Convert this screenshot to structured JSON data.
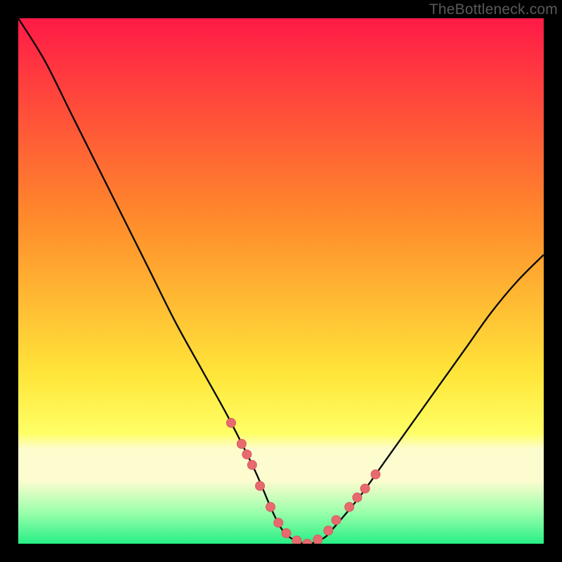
{
  "watermark": "TheBottleneck.com",
  "colors": {
    "frame": "#000000",
    "grad_top": "#ff1a47",
    "grad_mid1": "#ff8a2b",
    "grad_mid2": "#ffe63a",
    "grad_band_pale": "#fdfccf",
    "grad_bottom": "#27ef86",
    "curve": "#0a0a0a",
    "marker_fill": "#e66a6e",
    "marker_stroke": "#d85a5e"
  },
  "chart_data": {
    "type": "line",
    "title": "",
    "xlabel": "",
    "ylabel": "",
    "xlim": [
      0,
      100
    ],
    "ylim": [
      0,
      100
    ],
    "series": [
      {
        "name": "bottleneck-curve",
        "x": [
          0,
          5,
          10,
          15,
          20,
          25,
          30,
          35,
          40,
          45,
          48,
          50,
          52,
          55,
          58,
          60,
          65,
          70,
          75,
          80,
          85,
          90,
          95,
          100
        ],
        "y": [
          100,
          92,
          82,
          72,
          62,
          52,
          42,
          33,
          24,
          14,
          7,
          3,
          1,
          0,
          1,
          3,
          9,
          16,
          23,
          30,
          37,
          44,
          50,
          55
        ]
      }
    ],
    "markers": {
      "name": "highlight-points",
      "x": [
        40.5,
        42.5,
        43.5,
        44.5,
        46.0,
        48.0,
        49.5,
        51.0,
        53.0,
        55.0,
        57.0,
        59.0,
        60.5,
        63.0,
        64.5,
        66.0,
        68.0
      ],
      "y": [
        23.0,
        19.0,
        17.0,
        15.0,
        11.0,
        7.0,
        4.0,
        2.0,
        0.6,
        0.0,
        0.8,
        2.5,
        4.5,
        7.0,
        8.8,
        10.5,
        13.2
      ]
    },
    "gradient_bands": [
      {
        "y0": 100,
        "y1": 30,
        "from": "grad_top",
        "to": "grad_mid2"
      },
      {
        "y0": 30,
        "y1": 20,
        "color": "#ffe63a"
      },
      {
        "y0": 20,
        "y1": 12,
        "color": "#fdfccf"
      },
      {
        "y0": 12,
        "y1": 6,
        "from": "#fdfccf",
        "to": "#c6ffae"
      },
      {
        "y0": 6,
        "y1": 0,
        "color": "#27ef86"
      }
    ]
  }
}
